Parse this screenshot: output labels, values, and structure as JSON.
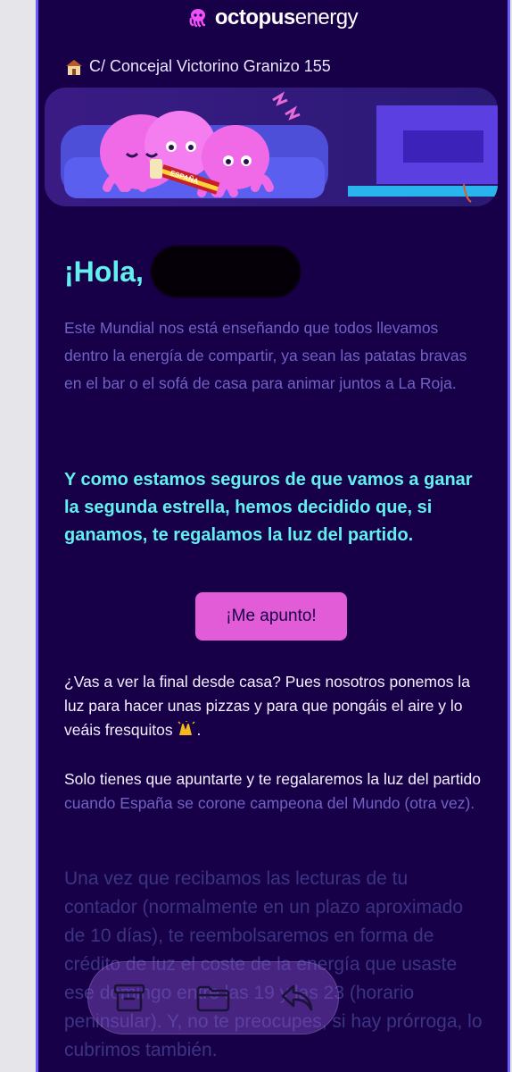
{
  "brand": {
    "name_bold": "octopus",
    "name_light": "energy"
  },
  "address": {
    "text": "C/ Concejal Victorino Granizo 155"
  },
  "hero": {
    "scarf_text": "ESPAÑA"
  },
  "greeting": {
    "text": "¡Hola,"
  },
  "body": {
    "p1": "Este Mundial nos está enseñando que todos llevamos dentro la energía de compartir, ya sean las patatas bravas en el bar o el sofá de casa para animar juntos a La Roja.",
    "highlight": "Y como estamos seguros de que vamos a ganar la segunda estrella, hemos decidido que, si ganamos, te regalamos la luz del partido.",
    "cta_label": "¡Me apunto!",
    "p2": "¿Vas a ver la final desde casa? Pues nosotros ponemos la luz para hacer unas pizzas y para que pongáis el aire y lo veáis fresquitos",
    "p3_a": "Solo tienes que apuntarte y te regalaremos la luz del partido",
    "p3_b": " cuando España se corone campeona del Mundo (otra vez).",
    "p4": "Una vez que recibamos las lecturas de tu contador (normalmente en un plazo aproximado de 10 días), te reembolsaremos en forma de crédito de luz el coste de la energía que usaste ese domingo entre las 19 y las 23 (horario peninsular). Y, no te preocupes, si hay prórroga, lo cubrimos también."
  },
  "toolbar": {
    "icons": [
      "archive-icon",
      "folder-icon",
      "reply-icon"
    ]
  },
  "colors": {
    "background": "#180048",
    "accent_cyan": "#61f0ee",
    "cta_pink": "#e25cd8"
  }
}
